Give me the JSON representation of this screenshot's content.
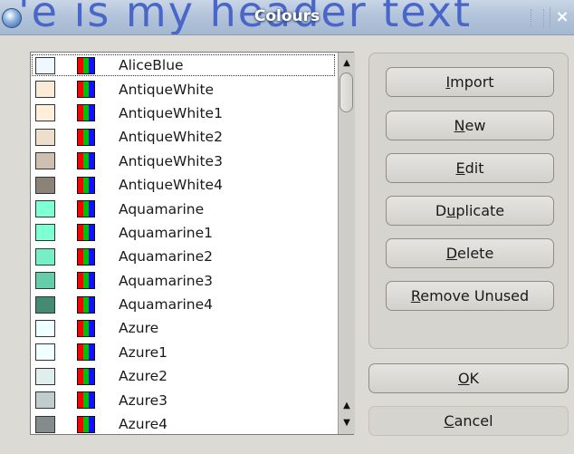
{
  "window": {
    "title": "Colours",
    "background_text": "'e is my header text",
    "close_glyph": "×"
  },
  "colours": [
    {
      "name": "AliceBlue",
      "swatch": "#f0f8ff"
    },
    {
      "name": "AntiqueWhite",
      "swatch": "#faebd7"
    },
    {
      "name": "AntiqueWhite1",
      "swatch": "#ffefdb"
    },
    {
      "name": "AntiqueWhite2",
      "swatch": "#eedfcc"
    },
    {
      "name": "AntiqueWhite3",
      "swatch": "#cdc0b0"
    },
    {
      "name": "AntiqueWhite4",
      "swatch": "#8b8378"
    },
    {
      "name": "Aquamarine",
      "swatch": "#7fffd4"
    },
    {
      "name": "Aquamarine1",
      "swatch": "#7fffd4"
    },
    {
      "name": "Aquamarine2",
      "swatch": "#76eec6"
    },
    {
      "name": "Aquamarine3",
      "swatch": "#66cdaa"
    },
    {
      "name": "Aquamarine4",
      "swatch": "#458b74"
    },
    {
      "name": "Azure",
      "swatch": "#f0ffff"
    },
    {
      "name": "Azure1",
      "swatch": "#f0ffff"
    },
    {
      "name": "Azure2",
      "swatch": "#e0eeee"
    },
    {
      "name": "Azure3",
      "swatch": "#c1cdcd"
    },
    {
      "name": "Azure4",
      "swatch": "#838b8b"
    }
  ],
  "selected_index": 0,
  "buttons": {
    "import": {
      "pre": "",
      "mn": "I",
      "post": "mport"
    },
    "new": {
      "pre": "",
      "mn": "N",
      "post": "ew"
    },
    "edit": {
      "pre": "",
      "mn": "E",
      "post": "dit"
    },
    "duplicate": {
      "pre": "D",
      "mn": "u",
      "post": "plicate"
    },
    "delete": {
      "pre": "",
      "mn": "D",
      "post": "elete"
    },
    "remove_unused": {
      "pre": "",
      "mn": "R",
      "post": "emove Unused"
    },
    "ok": {
      "pre": "",
      "mn": "O",
      "post": "K"
    },
    "cancel": {
      "pre": "",
      "mn": "C",
      "post": "ancel"
    }
  },
  "scrollbar": {
    "up_glyph": "▲",
    "down_glyph": "▼"
  }
}
